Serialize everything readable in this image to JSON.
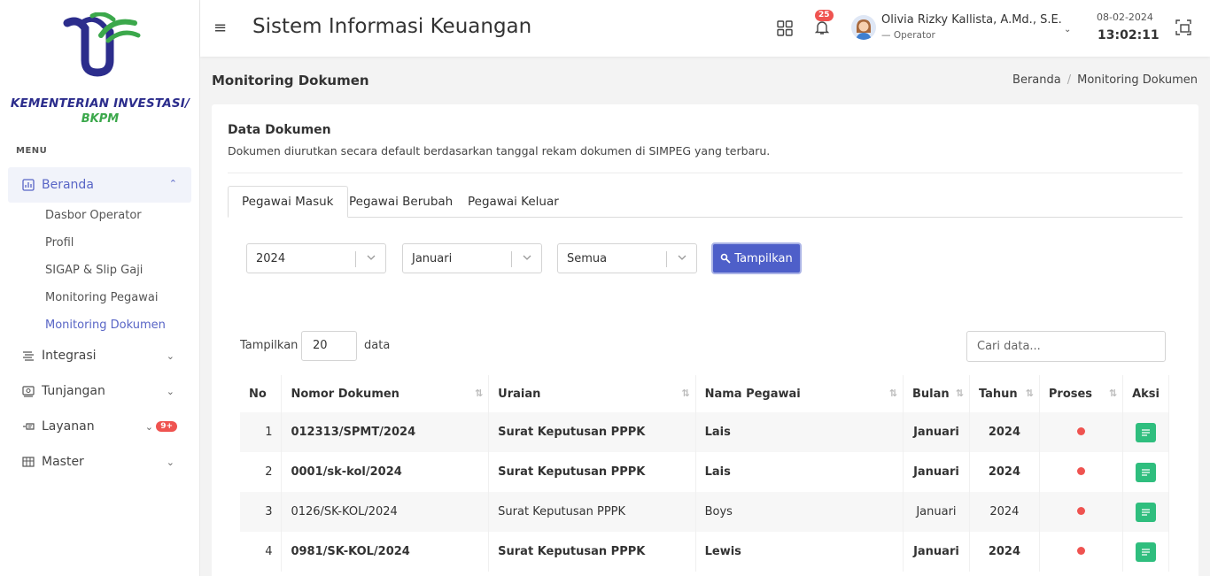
{
  "brand": {
    "line1": "KEMENTERIAN INVESTASI/",
    "line2": "BKPM"
  },
  "sidebar": {
    "menu_label": "MENU",
    "beranda": "Beranda",
    "subitems": [
      "Dasbor Operator",
      "Profil",
      "SIGAP & Slip Gaji",
      "Monitoring Pegawai",
      "Monitoring Dokumen"
    ],
    "items": [
      {
        "label": "Integrasi",
        "icon": "integration-icon"
      },
      {
        "label": "Tunjangan",
        "icon": "allowance-icon"
      },
      {
        "label": "Layanan",
        "icon": "service-icon",
        "badge": "9+"
      },
      {
        "label": "Master",
        "icon": "master-icon"
      }
    ]
  },
  "header": {
    "title": "Sistem Informasi Keuangan",
    "notif_count": "25",
    "user_name": "Olivia Rizky Kallista, A.Md., S.E.",
    "user_role": "— Operator",
    "date": "08-02-2024",
    "time": "13:02:11"
  },
  "page": {
    "title": "Monitoring Dokumen",
    "breadcrumb": [
      "Beranda",
      "Monitoring Dokumen"
    ]
  },
  "card": {
    "title": "Data Dokumen",
    "desc": "Dokumen diurutkan secara default berdasarkan tanggal rekam dokumen di SIMPEG yang terbaru.",
    "tabs": [
      "Pegawai Masuk",
      "Pegawai Berubah",
      "Pegawai Keluar"
    ],
    "filters": {
      "year": "2024",
      "month": "Januari",
      "status": "Semua",
      "button": "Tampilkan"
    },
    "length_label": "Tampilkan",
    "length_value": "20",
    "length_suffix": "data",
    "search_placeholder": "Cari data..."
  },
  "table": {
    "columns": [
      "No",
      "Nomor Dokumen",
      "Uraian",
      "Nama Pegawai",
      "Bulan",
      "Tahun",
      "Proses",
      "Aksi"
    ],
    "rows": [
      {
        "no": "1",
        "nomor": "012313/SPMT/2024",
        "uraian": "Surat Keputusan PPPK",
        "nama": "Lais",
        "bulan": "Januari",
        "tahun": "2024"
      },
      {
        "no": "2",
        "nomor": "0001/sk-kol/2024",
        "uraian": "Surat Keputusan PPPK",
        "nama": "Lais",
        "bulan": "Januari",
        "tahun": "2024"
      },
      {
        "no": "3",
        "nomor": "0126/SK-KOL/2024",
        "uraian": "Surat Keputusan PPPK",
        "nama": "Boys",
        "bulan": "Januari",
        "tahun": "2024"
      },
      {
        "no": "4",
        "nomor": "0981/SK-KOL/2024",
        "uraian": "Surat Keputusan PPPK",
        "nama": "Lewis",
        "bulan": "Januari",
        "tahun": "2024"
      }
    ]
  },
  "colors": {
    "accent": "#4e5fc9",
    "success": "#2fbe7e",
    "danger": "#ef5350"
  }
}
